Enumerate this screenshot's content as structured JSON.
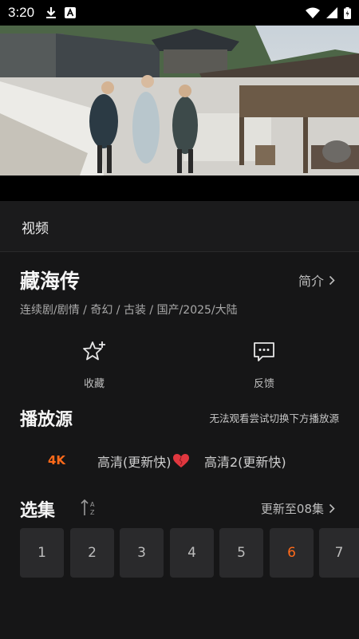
{
  "status_bar": {
    "time": "3:20",
    "icons_left": [
      "download-icon",
      "a-badge-icon"
    ],
    "icons_right": [
      "wifi-icon",
      "signal-icon",
      "battery-icon"
    ]
  },
  "video": {
    "tab_label": "视频"
  },
  "show": {
    "title": "藏海传",
    "intro_label": "简介",
    "genres": "连续剧/剧情 / 奇幻 / 古装 / 国产/2025/大陆"
  },
  "actions": {
    "favorite_label": "收藏",
    "feedback_label": "反馈"
  },
  "sources": {
    "title": "播放源",
    "hint": "无法观看尝试切换下方播放源",
    "items": [
      "4K",
      "高清(更新快)",
      "高清2(更新快)"
    ],
    "selected": "4K"
  },
  "episodes": {
    "title": "选集",
    "update_label": "更新至08集",
    "items": [
      "1",
      "2",
      "3",
      "4",
      "5",
      "6",
      "7"
    ],
    "current": "6"
  },
  "colors": {
    "accent": "#ff6a1a",
    "background": "#161617",
    "tile": "#2a2a2c"
  }
}
